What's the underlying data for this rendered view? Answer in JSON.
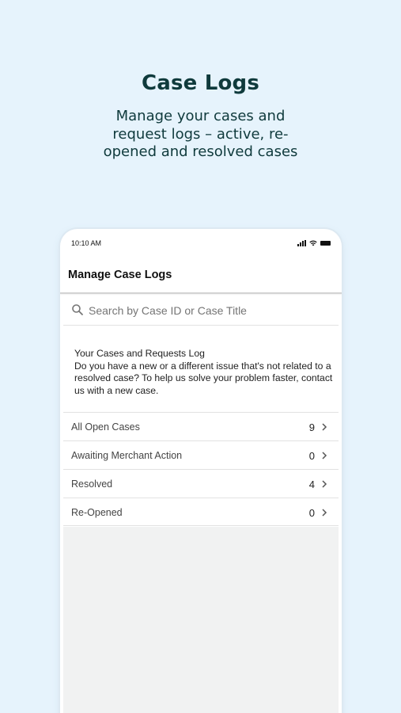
{
  "promo": {
    "title": "Case Logs",
    "subtitle_lines": [
      "Manage your cases and",
      "request logs – active, re-",
      "opened and resolved cases"
    ]
  },
  "status_bar": {
    "time": "10:10 AM",
    "icons": [
      "cellular-signal-icon",
      "wifi-icon",
      "battery-icon"
    ]
  },
  "app_bar": {
    "title": "Manage Case Logs"
  },
  "search": {
    "placeholder": "Search by Case ID or Case Title",
    "value": ""
  },
  "info": {
    "title": "Your Cases and Requests Log",
    "body": "Do you have a new or a different issue that's not related to a resolved case? To help us solve your problem faster, contact us with a new case."
  },
  "case_list": [
    {
      "label": "All Open Cases",
      "count": "9"
    },
    {
      "label": "Awaiting Merchant Action",
      "count": "0"
    },
    {
      "label": "Resolved",
      "count": "4"
    },
    {
      "label": "Re-Opened",
      "count": "0"
    }
  ],
  "colors": {
    "background": "#e6f3fc",
    "headline": "#0f3a3c",
    "empty_area": "#f1f2f2"
  }
}
